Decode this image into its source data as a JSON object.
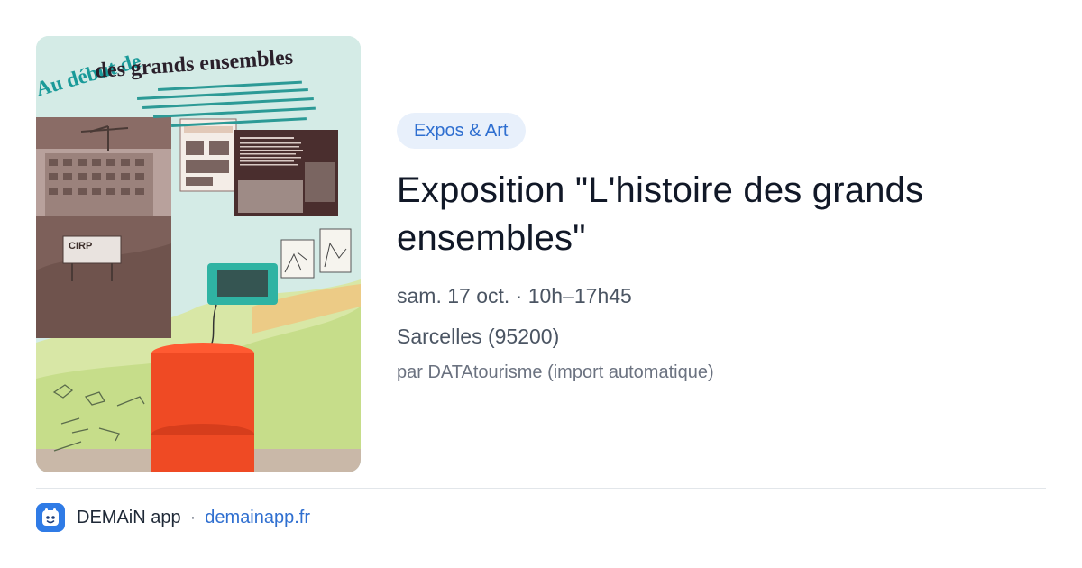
{
  "event": {
    "category": "Expos & Art",
    "title": "Exposition \"L'histoire des grands ensembles\"",
    "date_time": "sam. 17 oct. · 10h–17h45",
    "location": "Sarcelles (95200)",
    "source": "par DATAtourisme (import automatique)"
  },
  "image": {
    "poster_heading_line1": "Au début de",
    "poster_heading_line2": "des grands ensembles",
    "poster_sign": "CIRP"
  },
  "footer": {
    "app_name": "DEMAiN app",
    "separator": "·",
    "app_url": "demainapp.fr"
  },
  "colors": {
    "accent": "#2f6fd0",
    "pill_bg": "#e8f0fb",
    "logo_bg": "#2f7be6"
  }
}
